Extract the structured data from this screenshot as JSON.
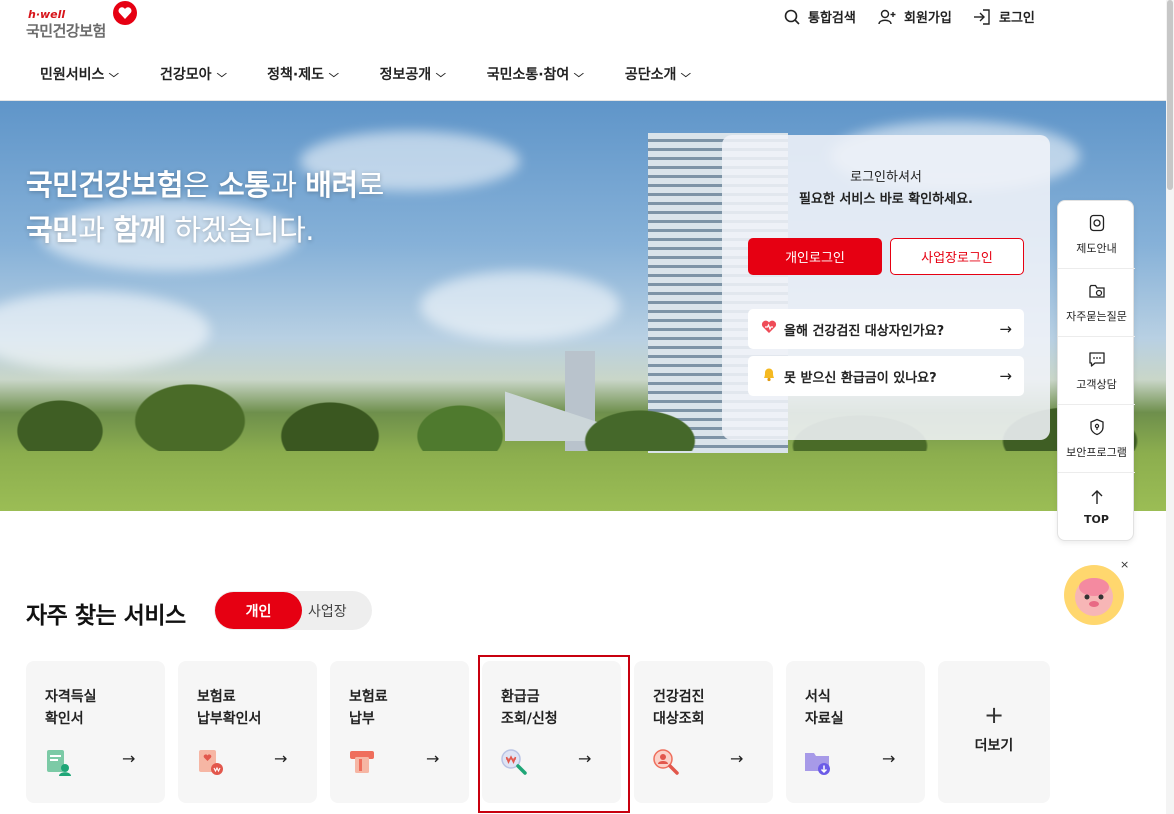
{
  "logo": {
    "tagline": "h·well",
    "name": "국민건강보험"
  },
  "utility": {
    "search": "통합검색",
    "signup": "회원가입",
    "login": "로그인"
  },
  "gnb": [
    {
      "label": "민원서비스"
    },
    {
      "label": "건강모아"
    },
    {
      "label": "정책·제도"
    },
    {
      "label": "정보공개"
    },
    {
      "label": "국민소통·참여"
    },
    {
      "label": "공단소개"
    }
  ],
  "hero": {
    "line1": {
      "b1": "국민건강보험",
      "t1": "은 ",
      "b2": "소통",
      "t2": "과 ",
      "b3": "배려",
      "t3": "로"
    },
    "line2": {
      "b1": "국민",
      "t1": "과 ",
      "b2": "함께",
      "t2": " 하겠습니다."
    }
  },
  "login_card": {
    "msg1": "로그인하셔서",
    "msg2": "필요한 서비스 바로 확인하세요.",
    "personal_login": "개인로그인",
    "business_login": "사업장로그인",
    "quick1": "올해 건강검진 대상자인가요?",
    "quick2": "못 받으신 환급금이 있나요?",
    "arrow": "→"
  },
  "float_menu": {
    "system": "제도안내",
    "faq": "자주묻는질문",
    "consult": "고객상담",
    "security": "보안프로그램",
    "top": "TOP"
  },
  "mascot": {
    "close": "×"
  },
  "services": {
    "title": "자주 찾는 서비스",
    "tab_personal": "개인",
    "tab_business": "사업장",
    "cards": [
      {
        "label": "자격득실\n확인서",
        "icon": "certificate-icon"
      },
      {
        "label": "보험료\n납부확인서",
        "icon": "payment-certificate-icon"
      },
      {
        "label": "보험료\n납부",
        "icon": "card-payment-icon"
      },
      {
        "label": "환급금\n조회/신청",
        "icon": "refund-search-icon"
      },
      {
        "label": "건강검진\n대상조회",
        "icon": "checkup-search-icon"
      },
      {
        "label": "서식\n자료실",
        "icon": "folder-download-icon"
      }
    ],
    "more": "더보기",
    "more_plus": "+",
    "arrow": "→"
  },
  "colors": {
    "brand_red": "#e60012",
    "highlight": "#c8000f"
  }
}
